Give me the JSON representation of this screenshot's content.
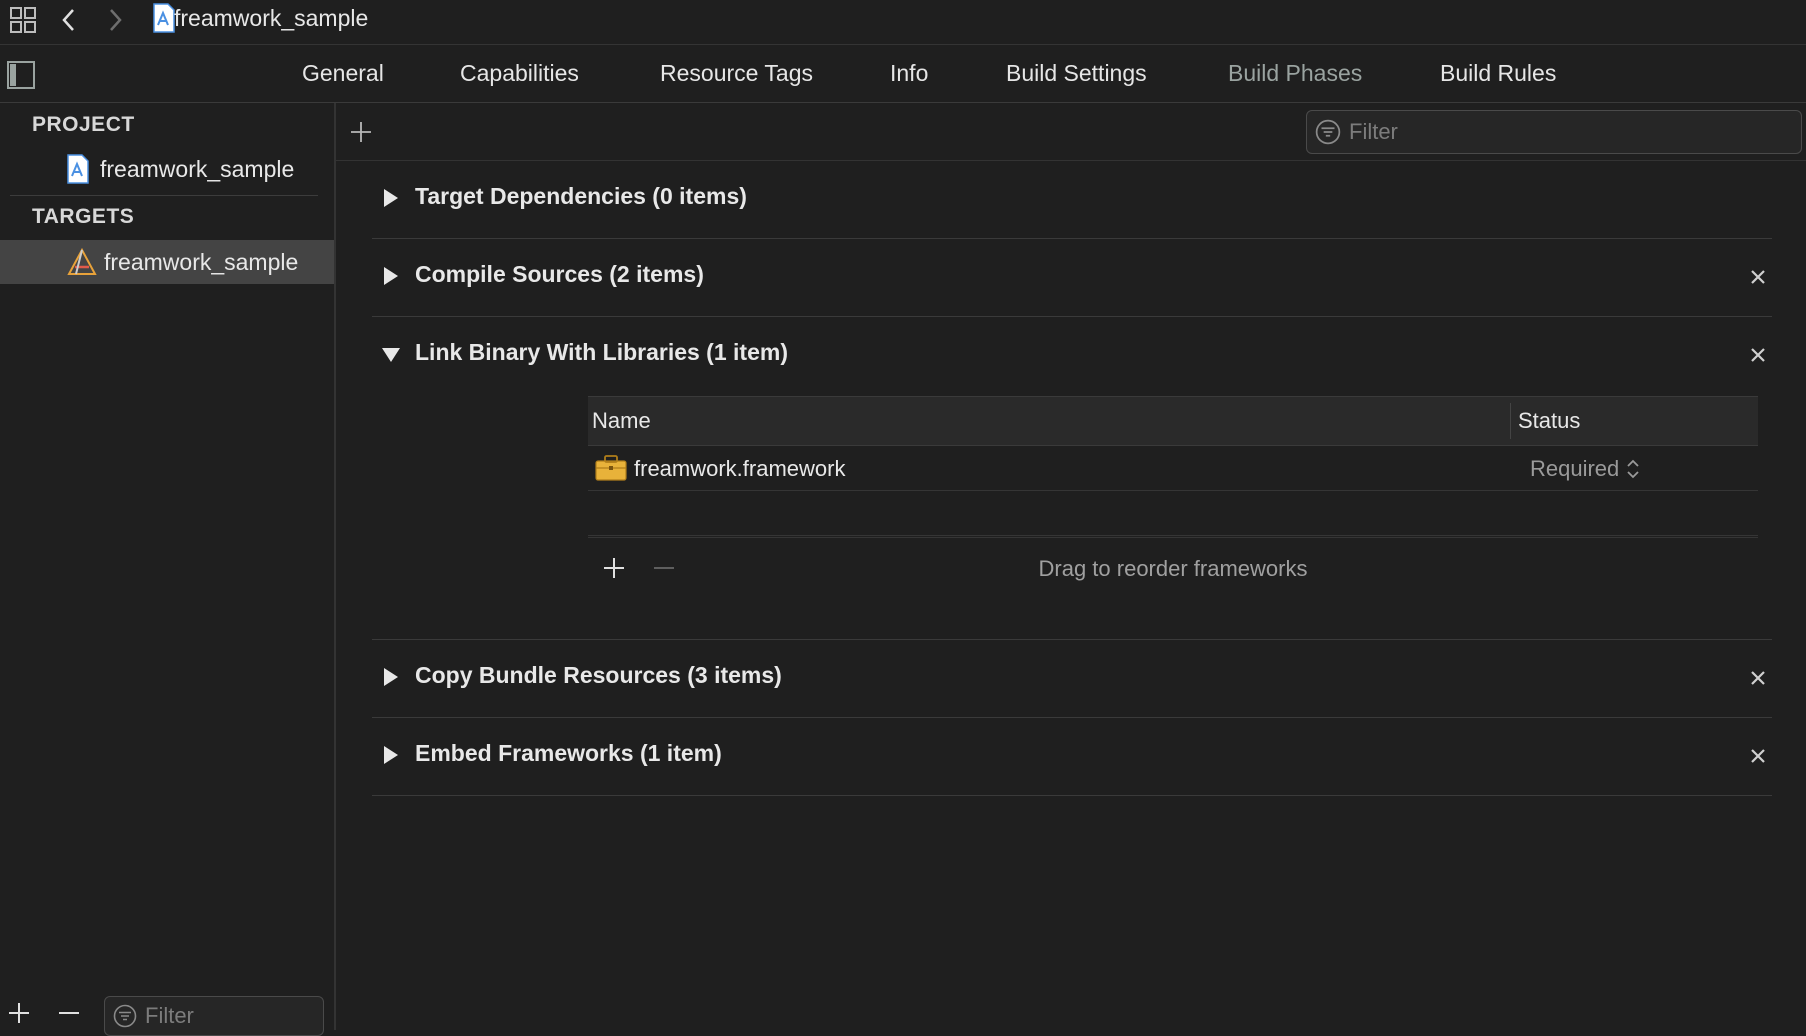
{
  "window": {
    "title": "freamwork_sample"
  },
  "tabs": [
    {
      "label": "General",
      "active": false
    },
    {
      "label": "Capabilities",
      "active": false
    },
    {
      "label": "Resource Tags",
      "active": false
    },
    {
      "label": "Info",
      "active": false
    },
    {
      "label": "Build Settings",
      "active": false
    },
    {
      "label": "Build Phases",
      "active": true
    },
    {
      "label": "Build Rules",
      "active": false
    }
  ],
  "sidebar": {
    "project_heading": "PROJECT",
    "project_item": "freamwork_sample",
    "targets_heading": "TARGETS",
    "target_item": "freamwork_sample",
    "filter_placeholder": "Filter"
  },
  "main": {
    "filter_placeholder": "Filter",
    "phases": [
      {
        "title": "Target Dependencies (0 items)",
        "expanded": false,
        "removable": false
      },
      {
        "title": "Compile Sources (2 items)",
        "expanded": false,
        "removable": true
      },
      {
        "title": "Link Binary With Libraries (1 item)",
        "expanded": true,
        "removable": true
      },
      {
        "title": "Copy Bundle Resources (3 items)",
        "expanded": false,
        "removable": true
      },
      {
        "title": "Embed Frameworks (1 item)",
        "expanded": false,
        "removable": true
      }
    ],
    "libraries": {
      "col_name": "Name",
      "col_status": "Status",
      "rows": [
        {
          "name": "freamwork.framework",
          "status": "Required"
        }
      ],
      "hint": "Drag to reorder frameworks"
    }
  },
  "colors": {
    "background": "#1f1f1f",
    "selected_row": "#444444",
    "active_tab": "#9aa3a0",
    "folder_icon": "#e8b23a",
    "project_icon": "#4a90e2"
  }
}
